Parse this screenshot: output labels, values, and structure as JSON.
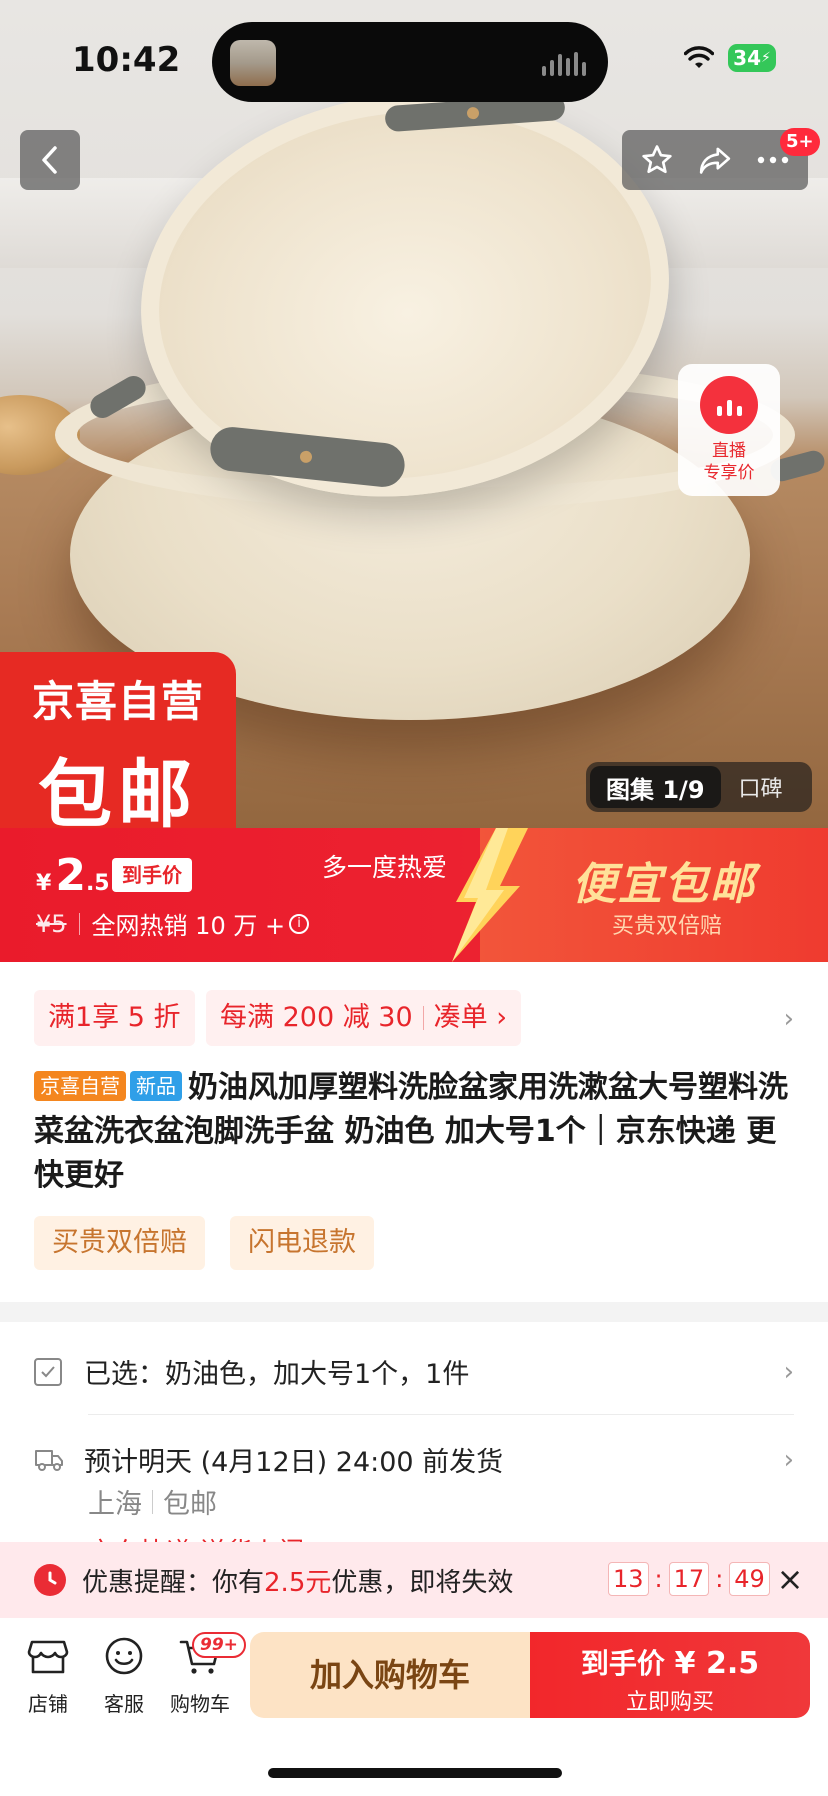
{
  "status_bar": {
    "time": "10:42",
    "battery": "34"
  },
  "nav": {
    "badge": "5+"
  },
  "live_badge": {
    "line1": "直播",
    "line2": "专享价"
  },
  "promo_badge": {
    "line1": "京喜自营",
    "line2": "包邮"
  },
  "gallery": {
    "active": "图集 1/9",
    "other": "口碑"
  },
  "price": {
    "currency": "¥",
    "integer": "2",
    "decimal": ".5",
    "tag": "到手价",
    "original": "¥5",
    "sales": "全网热销 10 万 +",
    "slogan_left": "多一度热爱",
    "slogan_big": "便宜包邮",
    "slogan_small": "买贵双倍赔"
  },
  "coupons": [
    {
      "text": "满1享 5 折"
    },
    {
      "text": "每满 200 减 30",
      "action": "凑单 ›"
    }
  ],
  "product": {
    "tag_self": "京喜自营",
    "tag_new": "新品",
    "title": "奶油风加厚塑料洗脸盆家用洗漱盆大号塑料洗菜盆洗衣盆泡脚洗手盆 奶油色 加大号1个｜京东快递 更快更好"
  },
  "service_tags": [
    "买贵双倍赔",
    "闪电退款"
  ],
  "spec": {
    "selected": "已选：奶油色，加大号1个，1件",
    "delivery": "预计明天 (4月12日) 24:00 前发货",
    "from": "上海",
    "shipping": "包邮",
    "cut_text": "京东快递  送货上门"
  },
  "reminder": {
    "label": "优惠提醒：你有",
    "amount": "2.5元",
    "suffix": "优惠，即将失效",
    "hours": "13",
    "minutes": "17",
    "seconds": "49"
  },
  "bottom_bar": {
    "tabs": [
      {
        "label": "店铺",
        "icon": "store-icon"
      },
      {
        "label": "客服",
        "icon": "customer-service-icon"
      },
      {
        "label": "购物车",
        "icon": "cart-icon"
      }
    ],
    "cart_badge": "99+",
    "add_to_cart": "加入购物车",
    "buy_price_label": "到手价 ",
    "buy_price": "¥ 2.5",
    "buy_now": "立即购买"
  },
  "colors": {
    "brand_red": "#ea1b2b",
    "accent_gold": "#ffe199",
    "cart_button_bg": "#fde3c5"
  }
}
